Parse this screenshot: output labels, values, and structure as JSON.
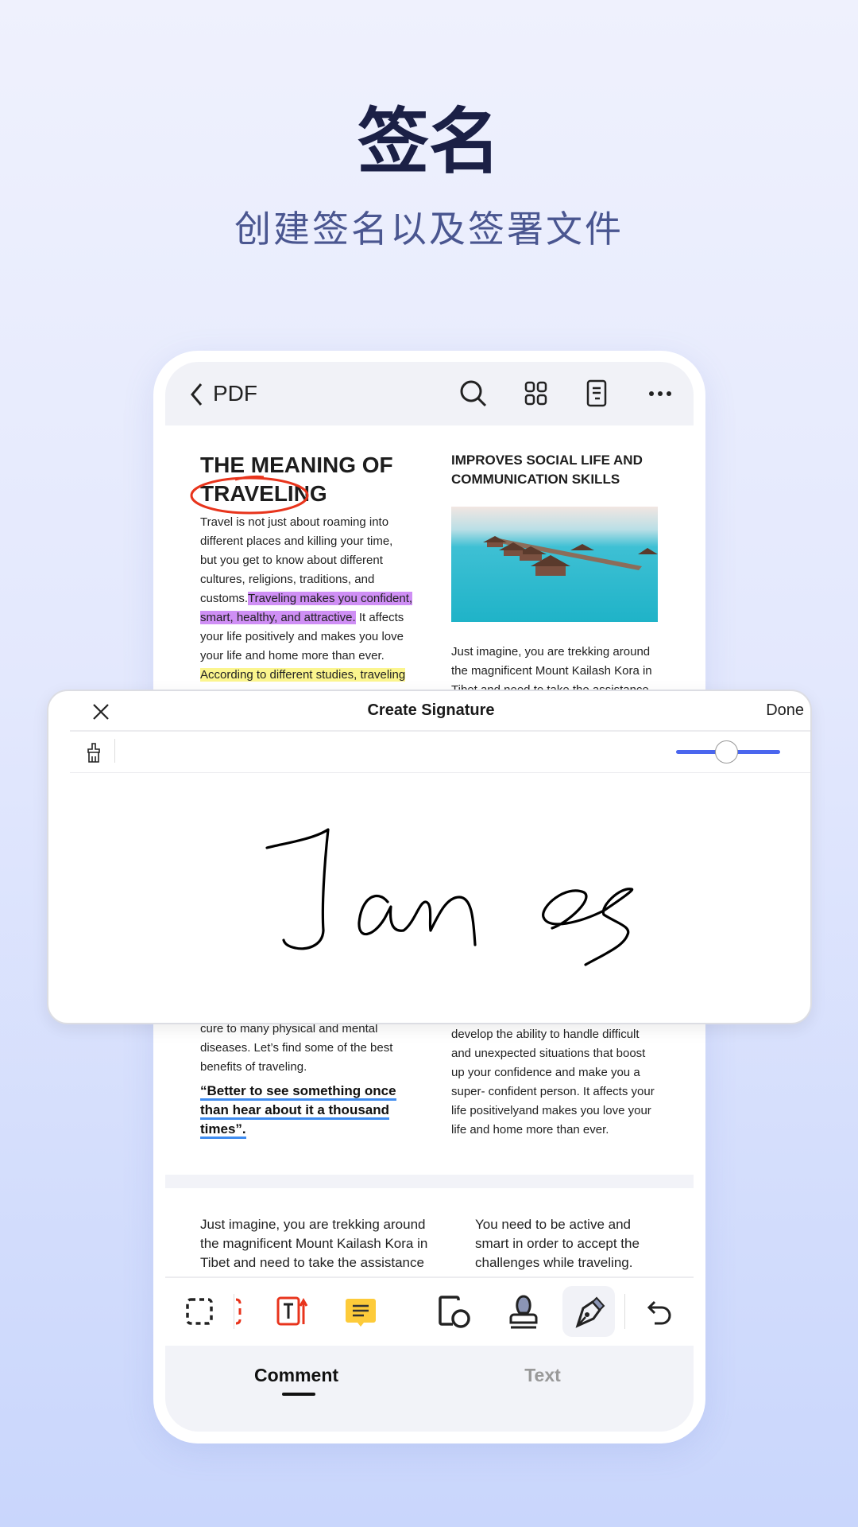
{
  "hero": {
    "title": "签名",
    "subtitle": "创建签名以及签署文件"
  },
  "topbar": {
    "back_label": "PDF",
    "icons": [
      "chevron-left-icon",
      "search-icon",
      "grid-icon",
      "document-icon",
      "more-icon"
    ]
  },
  "document": {
    "left_title_line1": "THE MEANING OF",
    "left_title_line2": "TRAVELING",
    "left_body": [
      "Travel is not just about roaming into",
      "different places and killing your time,",
      "but you get to know about different",
      "cultures, religions, traditions, and"
    ],
    "left_custom_prefix": "customs.",
    "left_highlight_purple_1": "Traveling makes you confident,",
    "left_highlight_purple_2": "smart, healthy, and attractive.",
    "left_after_highlight": " It affects",
    "left_body_2": [
      "your life positively and makes you love",
      "your life and home more than ever."
    ],
    "left_highlight_yellow": "According to different studies, traveling",
    "right_title_line1": "IMPROVES SOCIAL LIFE AND",
    "right_title_line2": "COMMUNICATION SKILLS",
    "right_body": [
      "Just imagine, you are trekking around",
      "the magnificent Mount Kailash Kora in",
      "Tibet and need to take the assistance"
    ],
    "left_lower": [
      "cure to many physical and mental",
      "diseases. Let’s find some of the best",
      "benefits of traveling."
    ],
    "quote": [
      "“Better to see something once",
      "than hear about it a thousand",
      "times”."
    ],
    "right_lower": [
      "develop the ability to handle difficult",
      "and unexpected situations that boost",
      "up your confidence and make you a",
      "super- confident person. It affects your",
      "life positivelyand makes you love your",
      "life and home more than ever."
    ],
    "page2_left": [
      "Just imagine, you are trekking around",
      "the magnificent Mount Kailash Kora in",
      "Tibet and need to take the assistance"
    ],
    "page2_right": [
      "You need to be active and",
      "smart in order to accept the",
      "challenges while traveling."
    ]
  },
  "signature": {
    "title": "Create Signature",
    "done_label": "Done",
    "stroke_width_fraction": 0.5,
    "accent": "#4a66ee",
    "signature_text": "James"
  },
  "toolbar": {
    "icons": [
      "marquee-select-icon",
      "shape-partial-icon",
      "text-box-icon",
      "note-icon",
      "shape-icon",
      "stamp-icon",
      "pen-icon",
      "undo-icon"
    ],
    "active": "pen-icon"
  },
  "tabs": [
    {
      "label": "Comment",
      "active": true
    },
    {
      "label": "Text",
      "active": false
    }
  ]
}
